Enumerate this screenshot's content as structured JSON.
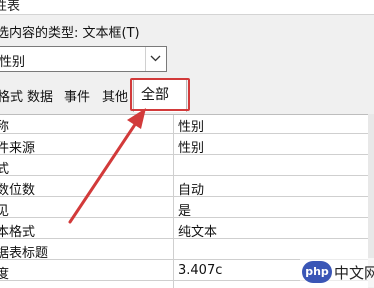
{
  "window": {
    "title": "性表"
  },
  "selection": {
    "label": "选内容的类型: 文本框(T)",
    "combo_value": "性别"
  },
  "tabs": [
    {
      "label": "格式"
    },
    {
      "label": "数据"
    },
    {
      "label": "事件"
    },
    {
      "label": "其他"
    },
    {
      "label": "全部",
      "selected": true
    }
  ],
  "properties": [
    {
      "name": "称",
      "value": "性别"
    },
    {
      "name": "件来源",
      "value": "性别"
    },
    {
      "name": "式",
      "value": ""
    },
    {
      "name": "数位数",
      "value": "自动"
    },
    {
      "name": "见",
      "value": "是"
    },
    {
      "name": "本格式",
      "value": "纯文本"
    },
    {
      "name": "据表标题",
      "value": ""
    },
    {
      "name": "度",
      "value": "3.407c"
    }
  ],
  "annotation": {
    "highlight_color": "#d23a3a"
  },
  "watermark": {
    "logo": "php",
    "text": "中文网"
  }
}
